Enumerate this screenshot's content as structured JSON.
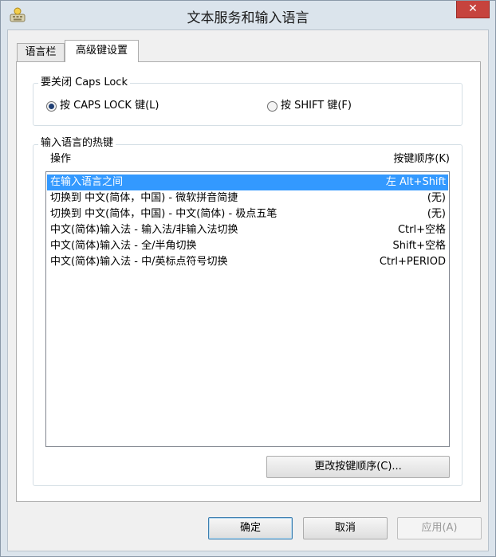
{
  "window": {
    "title": "文本服务和输入语言",
    "close_glyph": "✕"
  },
  "tabs": [
    {
      "label": "语言栏",
      "active": false
    },
    {
      "label": "高级键设置",
      "active": true
    }
  ],
  "caps_lock": {
    "group_label": "要关闭 Caps Lock",
    "options": [
      {
        "label": "按 CAPS LOCK 键(L)",
        "checked": true
      },
      {
        "label": "按 SHIFT 键(F)",
        "checked": false
      }
    ]
  },
  "hotkeys": {
    "group_label": "输入语言的热键",
    "col_action": "操作",
    "col_keys": "按键顺序(K)",
    "rows": [
      {
        "action": "在输入语言之间",
        "keys": "左 Alt+Shift",
        "selected": true
      },
      {
        "action": "切换到 中文(简体，中国) - 微软拼音简捷",
        "keys": "(无)",
        "selected": false
      },
      {
        "action": "切换到 中文(简体，中国) - 中文(简体) - 极点五笔",
        "keys": "(无)",
        "selected": false
      },
      {
        "action": "中文(简体)输入法 - 输入法/非输入法切换",
        "keys": "Ctrl+空格",
        "selected": false
      },
      {
        "action": "中文(简体)输入法 - 全/半角切换",
        "keys": "Shift+空格",
        "selected": false
      },
      {
        "action": "中文(简体)输入法 - 中/英标点符号切换",
        "keys": "Ctrl+PERIOD",
        "selected": false
      }
    ],
    "change_button": "更改按键顺序(C)..."
  },
  "footer": {
    "ok": "确定",
    "cancel": "取消",
    "apply": "应用(A)"
  },
  "colors": {
    "selection": "#3399ff",
    "close": "#c6433d"
  },
  "icons": {
    "app": "keyboard-icon",
    "close": "close-icon"
  }
}
